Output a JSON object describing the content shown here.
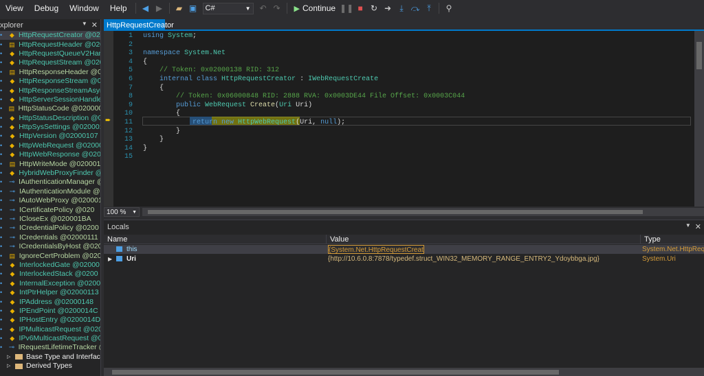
{
  "menu": [
    "View",
    "Debug",
    "Window",
    "Help"
  ],
  "toolbar": {
    "language": "C#",
    "continue_label": "Continue"
  },
  "explorer": {
    "title": "xplorer",
    "items": [
      {
        "label": "HttpRequestCreator @020",
        "color": "#4ec9b0",
        "icon": "class-icon",
        "selected": true
      },
      {
        "label": "HttpRequestHeader @020",
        "color": "#4ec9b0",
        "icon": "enum-icon"
      },
      {
        "label": "HttpRequestQueueV2Han",
        "color": "#4ec9b0",
        "icon": "class-icon"
      },
      {
        "label": "HttpRequestStream @020",
        "color": "#4ec9b0",
        "icon": "class-icon"
      },
      {
        "label": "HttpResponseHeader @0",
        "color": "#b8d7a3",
        "icon": "enum-icon"
      },
      {
        "label": "HttpResponseStream @0",
        "color": "#4ec9b0",
        "icon": "class-icon"
      },
      {
        "label": "HttpResponseStreamAsyn",
        "color": "#4ec9b0",
        "icon": "class-icon"
      },
      {
        "label": "HttpServerSessionHandle",
        "color": "#4ec9b0",
        "icon": "class-icon"
      },
      {
        "label": "HttpStatusCode @0200001",
        "color": "#b8d7a3",
        "icon": "enum-icon"
      },
      {
        "label": "HttpStatusDescription @0",
        "color": "#4ec9b0",
        "icon": "class-icon"
      },
      {
        "label": "HttpSysSettings @020001",
        "color": "#4ec9b0",
        "icon": "class-icon"
      },
      {
        "label": "HttpVersion @02000107",
        "color": "#4ec9b0",
        "icon": "class-icon"
      },
      {
        "label": "HttpWebRequest @02000",
        "color": "#4ec9b0",
        "icon": "class-icon"
      },
      {
        "label": "HttpWebResponse @020",
        "color": "#4ec9b0",
        "icon": "class-icon"
      },
      {
        "label": "HttpWriteMode @020001",
        "color": "#b8d7a3",
        "icon": "enum-icon"
      },
      {
        "label": "HybridWebProxyFinder @",
        "color": "#4ec9b0",
        "icon": "class-icon"
      },
      {
        "label": "IAuthenticationManager @",
        "color": "#b8d7a3",
        "icon": "interface-icon"
      },
      {
        "label": "IAuthenticationModule @",
        "color": "#b8d7a3",
        "icon": "interface-icon"
      },
      {
        "label": "IAutoWebProxy @020001",
        "color": "#b8d7a3",
        "icon": "interface-icon"
      },
      {
        "label": "ICertificatePolicy @020",
        "color": "#b8d7a3",
        "icon": "interface-icon"
      },
      {
        "label": "ICloseEx @020001BA",
        "color": "#b8d7a3",
        "icon": "interface-icon"
      },
      {
        "label": "ICredentialPolicy @0200",
        "color": "#b8d7a3",
        "icon": "interface-icon"
      },
      {
        "label": "ICredentials @02000111",
        "color": "#b8d7a3",
        "icon": "interface-icon"
      },
      {
        "label": "ICredentialsByHost @020",
        "color": "#b8d7a3",
        "icon": "interface-icon"
      },
      {
        "label": "IgnoreCertProblem @020",
        "color": "#b8d7a3",
        "icon": "enum-icon"
      },
      {
        "label": "InterlockedGate @02000",
        "color": "#4ec9b0",
        "icon": "class-icon"
      },
      {
        "label": "InterlockedStack @0200",
        "color": "#4ec9b0",
        "icon": "class-icon"
      },
      {
        "label": "InternalException @0200",
        "color": "#4ec9b0",
        "icon": "class-icon"
      },
      {
        "label": "IntPtrHelper @02000113",
        "color": "#4ec9b0",
        "icon": "class-icon"
      },
      {
        "label": "IPAddress @02000148",
        "color": "#4ec9b0",
        "icon": "class-icon"
      },
      {
        "label": "IPEndPoint @0200014C",
        "color": "#4ec9b0",
        "icon": "class-icon"
      },
      {
        "label": "IPHostEntry @0200014D",
        "color": "#4ec9b0",
        "icon": "class-icon"
      },
      {
        "label": "IPMulticastRequest @020",
        "color": "#4ec9b0",
        "icon": "class-icon"
      },
      {
        "label": "IPv6MulticastRequest @0",
        "color": "#4ec9b0",
        "icon": "class-icon"
      },
      {
        "label": "IRequestLifetimeTracker @",
        "color": "#b8d7a3",
        "icon": "interface-icon"
      }
    ],
    "sub_items": [
      "Base Type and Interfac",
      "Derived Types"
    ]
  },
  "document": {
    "tab_title": "HttpRequestCreator"
  },
  "code": {
    "lines": [
      [
        {
          "t": "using ",
          "c": "kw"
        },
        {
          "t": "System",
          "c": "ty"
        },
        {
          "t": ";",
          "c": ""
        }
      ],
      [],
      [
        {
          "t": "namespace ",
          "c": "kw"
        },
        {
          "t": "System.Net",
          "c": "ty"
        }
      ],
      [
        {
          "t": "{",
          "c": ""
        }
      ],
      [
        {
          "t": "    // Token: 0x02000138 RID: 312",
          "c": "cm"
        }
      ],
      [
        {
          "t": "    internal class ",
          "c": "kw"
        },
        {
          "t": "HttpRequestCreator",
          "c": "ty"
        },
        {
          "t": " : ",
          "c": ""
        },
        {
          "t": "IWebRequestCreate",
          "c": "ty"
        }
      ],
      [
        {
          "t": "    {",
          "c": ""
        }
      ],
      [
        {
          "t": "        // Token: 0x06000848 RID: 2888 RVA: 0x0003DE44 File Offset: 0x0003C044",
          "c": "cm"
        }
      ],
      [
        {
          "t": "        public ",
          "c": "kw"
        },
        {
          "t": "WebRequest ",
          "c": "ty"
        },
        {
          "t": "Create",
          "c": "fn"
        },
        {
          "t": "(",
          "c": ""
        },
        {
          "t": "Uri ",
          "c": "ty"
        },
        {
          "t": "Uri",
          "c": ""
        },
        {
          "t": ")",
          "c": ""
        }
      ],
      [
        {
          "t": "        {",
          "c": ""
        }
      ],
      [
        {
          "t": "            return",
          "c": "kw"
        },
        {
          "t": " new ",
          "c": "kw"
        },
        {
          "t": "HttpWebRequest",
          "c": "ty"
        },
        {
          "t": "(Uri, ",
          "c": ""
        },
        {
          "t": "null",
          "c": "kw"
        },
        {
          "t": ");",
          "c": ""
        }
      ],
      [
        {
          "t": "        }",
          "c": ""
        }
      ],
      [
        {
          "t": "    }",
          "c": ""
        }
      ],
      [
        {
          "t": "}",
          "c": ""
        }
      ],
      []
    ]
  },
  "zoom": "100 %",
  "locals": {
    "title": "Locals",
    "columns": [
      "Name",
      "Value",
      "Type"
    ],
    "rows": [
      {
        "name": "this",
        "value": "{System.Net.HttpRequestCreator}",
        "type": "System.Net.HttpReq"
      },
      {
        "name": "Uri",
        "value": "{http://10.6.0.8:7878/typedef.struct_WIN32_MEMORY_RANGE_ENTRY2_Ydoybbga.jpg}",
        "type": "System.Uri"
      }
    ]
  },
  "colors": {
    "accent": "#007acc",
    "class_type": "#4ec9b0",
    "keyword": "#569cd6",
    "comment": "#57a64a"
  }
}
